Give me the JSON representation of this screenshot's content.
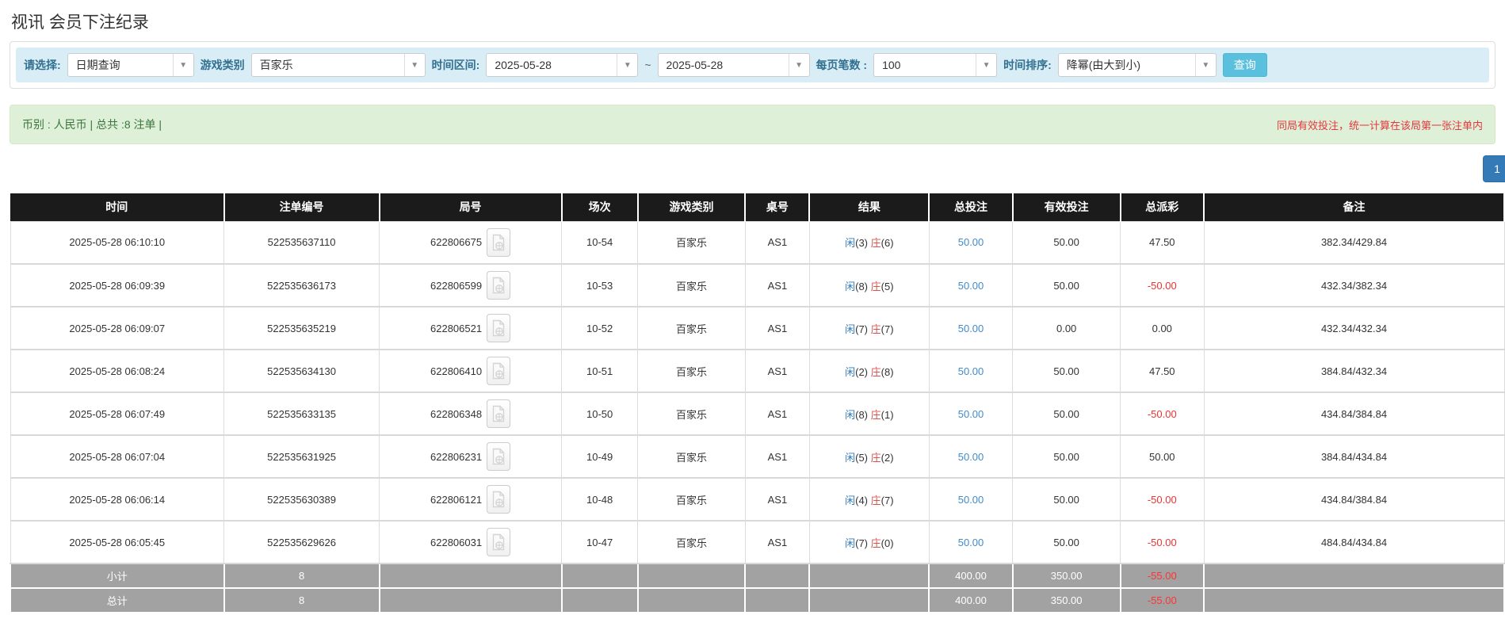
{
  "page": {
    "title": "视讯 会员下注纪录"
  },
  "colors": {
    "link_blue": "#428bca",
    "accent_blue": "#337ab7",
    "player_blue": "#337ab7",
    "banker_red": "#d9534f",
    "negative_red": "#ee3333",
    "header_bg": "#1b1b1b",
    "footer_bg": "#a2a2a2",
    "green_bg": "#dff0d8",
    "green_text": "#3c763d",
    "note_red": "#e4393c",
    "filter_bg": "#d9edf7",
    "search_bg": "#5bc0de"
  },
  "filters": {
    "select_label": "请选择:",
    "select_value": "日期查询",
    "game_type_label": "游戏类别",
    "game_type_value": "百家乐",
    "date_range_label": "时间区间:",
    "date_from": "2025-05-28",
    "tilde": "~",
    "date_to": "2025-05-28",
    "page_size_label": "每页笔数 :",
    "page_size_value": "100",
    "sort_label": "时间排序:",
    "sort_value": "降幂(由大到小)",
    "search_button": "查询",
    "dropdown_arrow": "▼"
  },
  "summary": {
    "left_text": "币别 : 人民币 | 总共 :8 注单 |",
    "right_text": "同局有效投注，统一计算在该局第一张注单内"
  },
  "pagination": {
    "current_page": "1"
  },
  "table": {
    "headers": [
      "时间",
      "注单编号",
      "局号",
      "场次",
      "游戏类别",
      "桌号",
      "结果",
      "总投注",
      "有效投注",
      "总派彩",
      "备注"
    ],
    "rows": [
      {
        "time": "2025-05-28 06:10:10",
        "bet_id": "522535637110",
        "round_id": "622806675",
        "session": "10-54",
        "game": "百家乐",
        "table_id": "AS1",
        "result": {
          "player": "闲",
          "player_val": "(3)",
          "banker": "庄",
          "banker_val": "(6)"
        },
        "total_bet": "50.00",
        "valid_bet": "50.00",
        "payout": "47.50",
        "remark": "382.34/429.84"
      },
      {
        "time": "2025-05-28 06:09:39",
        "bet_id": "522535636173",
        "round_id": "622806599",
        "session": "10-53",
        "game": "百家乐",
        "table_id": "AS1",
        "result": {
          "player": "闲",
          "player_val": "(8)",
          "banker": "庄",
          "banker_val": "(5)"
        },
        "total_bet": "50.00",
        "valid_bet": "50.00",
        "payout": "-50.00",
        "remark": "432.34/382.34"
      },
      {
        "time": "2025-05-28 06:09:07",
        "bet_id": "522535635219",
        "round_id": "622806521",
        "session": "10-52",
        "game": "百家乐",
        "table_id": "AS1",
        "result": {
          "player": "闲",
          "player_val": "(7)",
          "banker": "庄",
          "banker_val": "(7)"
        },
        "total_bet": "50.00",
        "valid_bet": "0.00",
        "payout": "0.00",
        "remark": "432.34/432.34"
      },
      {
        "time": "2025-05-28 06:08:24",
        "bet_id": "522535634130",
        "round_id": "622806410",
        "session": "10-51",
        "game": "百家乐",
        "table_id": "AS1",
        "result": {
          "player": "闲",
          "player_val": "(2)",
          "banker": "庄",
          "banker_val": "(8)"
        },
        "total_bet": "50.00",
        "valid_bet": "50.00",
        "payout": "47.50",
        "remark": "384.84/432.34"
      },
      {
        "time": "2025-05-28 06:07:49",
        "bet_id": "522535633135",
        "round_id": "622806348",
        "session": "10-50",
        "game": "百家乐",
        "table_id": "AS1",
        "result": {
          "player": "闲",
          "player_val": "(8)",
          "banker": "庄",
          "banker_val": "(1)"
        },
        "total_bet": "50.00",
        "valid_bet": "50.00",
        "payout": "-50.00",
        "remark": "434.84/384.84"
      },
      {
        "time": "2025-05-28 06:07:04",
        "bet_id": "522535631925",
        "round_id": "622806231",
        "session": "10-49",
        "game": "百家乐",
        "table_id": "AS1",
        "result": {
          "player": "闲",
          "player_val": "(5)",
          "banker": "庄",
          "banker_val": "(2)"
        },
        "total_bet": "50.00",
        "valid_bet": "50.00",
        "payout": "50.00",
        "remark": "384.84/434.84"
      },
      {
        "time": "2025-05-28 06:06:14",
        "bet_id": "522535630389",
        "round_id": "622806121",
        "session": "10-48",
        "game": "百家乐",
        "table_id": "AS1",
        "result": {
          "player": "闲",
          "player_val": "(4)",
          "banker": "庄",
          "banker_val": "(7)"
        },
        "total_bet": "50.00",
        "valid_bet": "50.00",
        "payout": "-50.00",
        "remark": "434.84/384.84"
      },
      {
        "time": "2025-05-28 06:05:45",
        "bet_id": "522535629626",
        "round_id": "622806031",
        "session": "10-47",
        "game": "百家乐",
        "table_id": "AS1",
        "result": {
          "player": "闲",
          "player_val": "(7)",
          "banker": "庄",
          "banker_val": "(0)"
        },
        "total_bet": "50.00",
        "valid_bet": "50.00",
        "payout": "-50.00",
        "remark": "484.84/434.84"
      }
    ],
    "subtotal": {
      "label": "小计",
      "count": "8",
      "total_bet": "400.00",
      "valid_bet": "350.00",
      "payout": "-55.00"
    },
    "total": {
      "label": "总计",
      "count": "8",
      "total_bet": "400.00",
      "valid_bet": "350.00",
      "payout": "-55.00"
    }
  }
}
